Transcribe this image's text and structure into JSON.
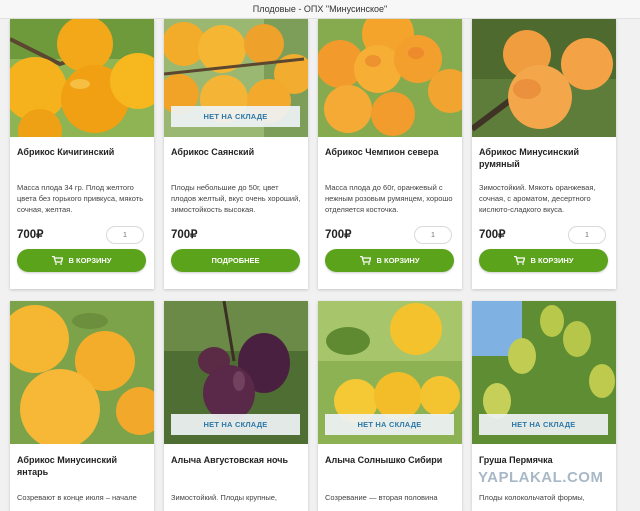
{
  "page": {
    "title": "Плодовые - ОПХ \"Минусинское\""
  },
  "labels": {
    "out_of_stock": "НЕТ НА СКЛАДЕ",
    "to_cart": "В КОРЗИНУ",
    "details": "ПОДРОБНЕЕ",
    "currency": "₽"
  },
  "colors": {
    "button_green": "#5aa31a",
    "stock_text": "#2e78a8"
  },
  "products": [
    {
      "name": "Абрикос Кичигинский",
      "description": "Масса плода 34 гр. Плод желтого цвета без горького привкуса, мякоть сочная, желтая.",
      "price": "700₽",
      "qty": "1",
      "button": "В КОРЗИНУ",
      "out_of_stock": false
    },
    {
      "name": "Абрикос Саянский",
      "description": "Плоды небольшие до 50г, цвет плодов желтый, вкус очень хороший, зимостойкость высокая.",
      "price": "700₽",
      "button": "ПОДРОБНЕЕ",
      "out_of_stock": true
    },
    {
      "name": "Абрикос Чемпион севера",
      "description": "Масса плода до 60г, оранжевый с нежным розовым румянцем, хорошо отделяется косточка.",
      "price": "700₽",
      "qty": "1",
      "button": "В КОРЗИНУ",
      "out_of_stock": false
    },
    {
      "name": "Абрикос Минусинский румяный",
      "description": "Зимостойкий. Мякоть оранжевая, сочная, с ароматом, десертного кислюто-сладкого вкуса.",
      "price": "700₽",
      "qty": "1",
      "button": "В КОРЗИНУ",
      "out_of_stock": false
    },
    {
      "name": "Абрикос Минусинский янтарь",
      "description": "Созревают в конце июля – начале",
      "out_of_stock": false
    },
    {
      "name": "Алыча Августовская ночь",
      "description": "Зимостойкий. Плоды крупные,",
      "out_of_stock": true
    },
    {
      "name": "Алыча Солнышко Сибири",
      "description": "Созревание — вторая половина",
      "out_of_stock": true
    },
    {
      "name": "Груша Пермячка",
      "description": "Плоды колокольчатой формы,",
      "out_of_stock": true
    }
  ],
  "watermark": "YAPLAKAL.COM"
}
